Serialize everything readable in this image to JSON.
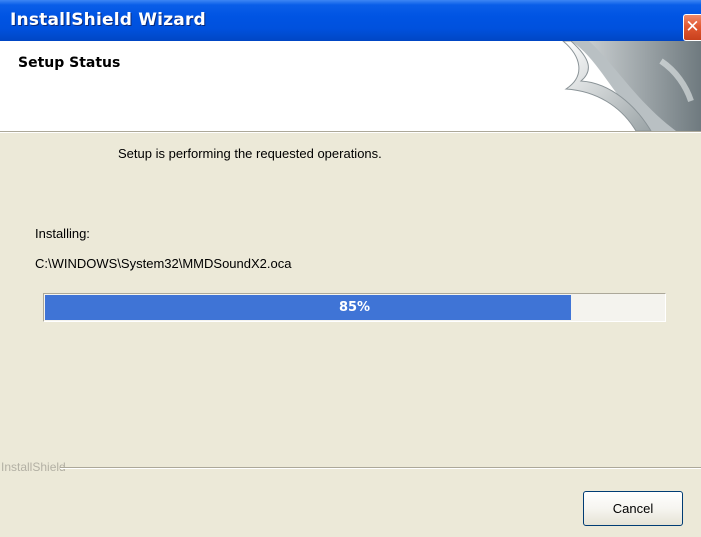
{
  "window": {
    "title": "InstallShield Wizard",
    "close_symbol": "✕"
  },
  "header": {
    "title": "Setup Status"
  },
  "body": {
    "status_message": "Setup is performing the requested operations.",
    "installing_label": "Installing:",
    "file_path": "C:\\WINDOWS\\System32\\MMDSoundX2.oca"
  },
  "progress": {
    "value": 0.85,
    "label": "85%"
  },
  "footer": {
    "brand": "InstallShield",
    "cancel_label": "Cancel"
  },
  "colors": {
    "titlebar": "#0054e3",
    "progress_fill": "#3f74d6",
    "dialog_bg": "#ece9d8"
  },
  "icons": {
    "close": "close-icon",
    "header_graphic": "page-curl-graphic"
  }
}
